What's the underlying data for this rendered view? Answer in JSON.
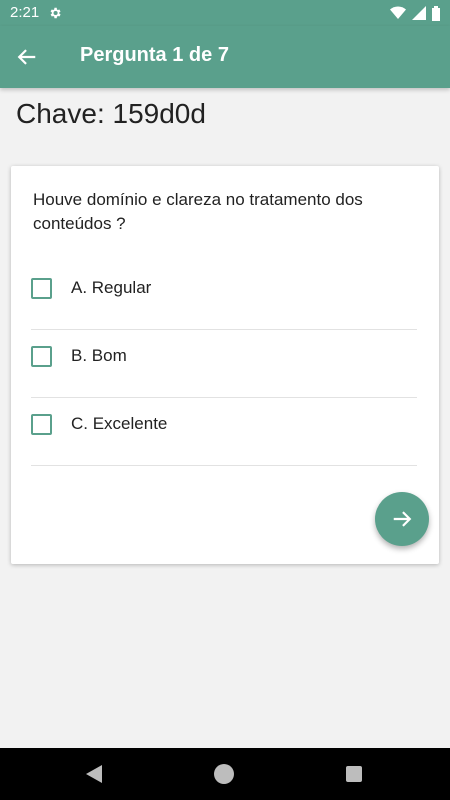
{
  "status_bar": {
    "time": "2:21",
    "icons": [
      "gear-icon",
      "wifi-icon",
      "signal-icon",
      "battery-icon"
    ]
  },
  "app_bar": {
    "title": "Pergunta 1 de 7",
    "back_icon": "arrow-left-icon"
  },
  "key": {
    "text": "Chave: 159d0d"
  },
  "card": {
    "question": "Houve domínio e clareza no tratamento dos conteúdos ?",
    "options": [
      {
        "label": "A. Regular",
        "checked": false
      },
      {
        "label": "B. Bom",
        "checked": false
      },
      {
        "label": "C. Excelente",
        "checked": false
      }
    ],
    "next_icon": "arrow-right-icon"
  },
  "nav_bar": {
    "icons": [
      "nav-back-icon",
      "nav-home-icon",
      "nav-recents-icon"
    ]
  },
  "colors": {
    "primary": "#5aa08c",
    "background": "#f2f2f2"
  }
}
